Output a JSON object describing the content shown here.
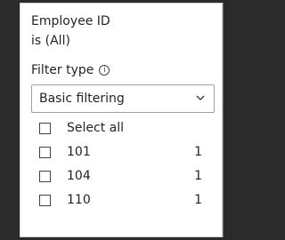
{
  "filter": {
    "title": "Employee ID",
    "subtitle": "is (All)",
    "filter_type_label": "Filter type",
    "info_glyph": "i",
    "selected_filter_type": "Basic filtering"
  },
  "list": {
    "select_all_label": "Select all",
    "items": [
      {
        "label": "101",
        "count": "1"
      },
      {
        "label": "104",
        "count": "1"
      },
      {
        "label": "110",
        "count": "1"
      }
    ]
  }
}
